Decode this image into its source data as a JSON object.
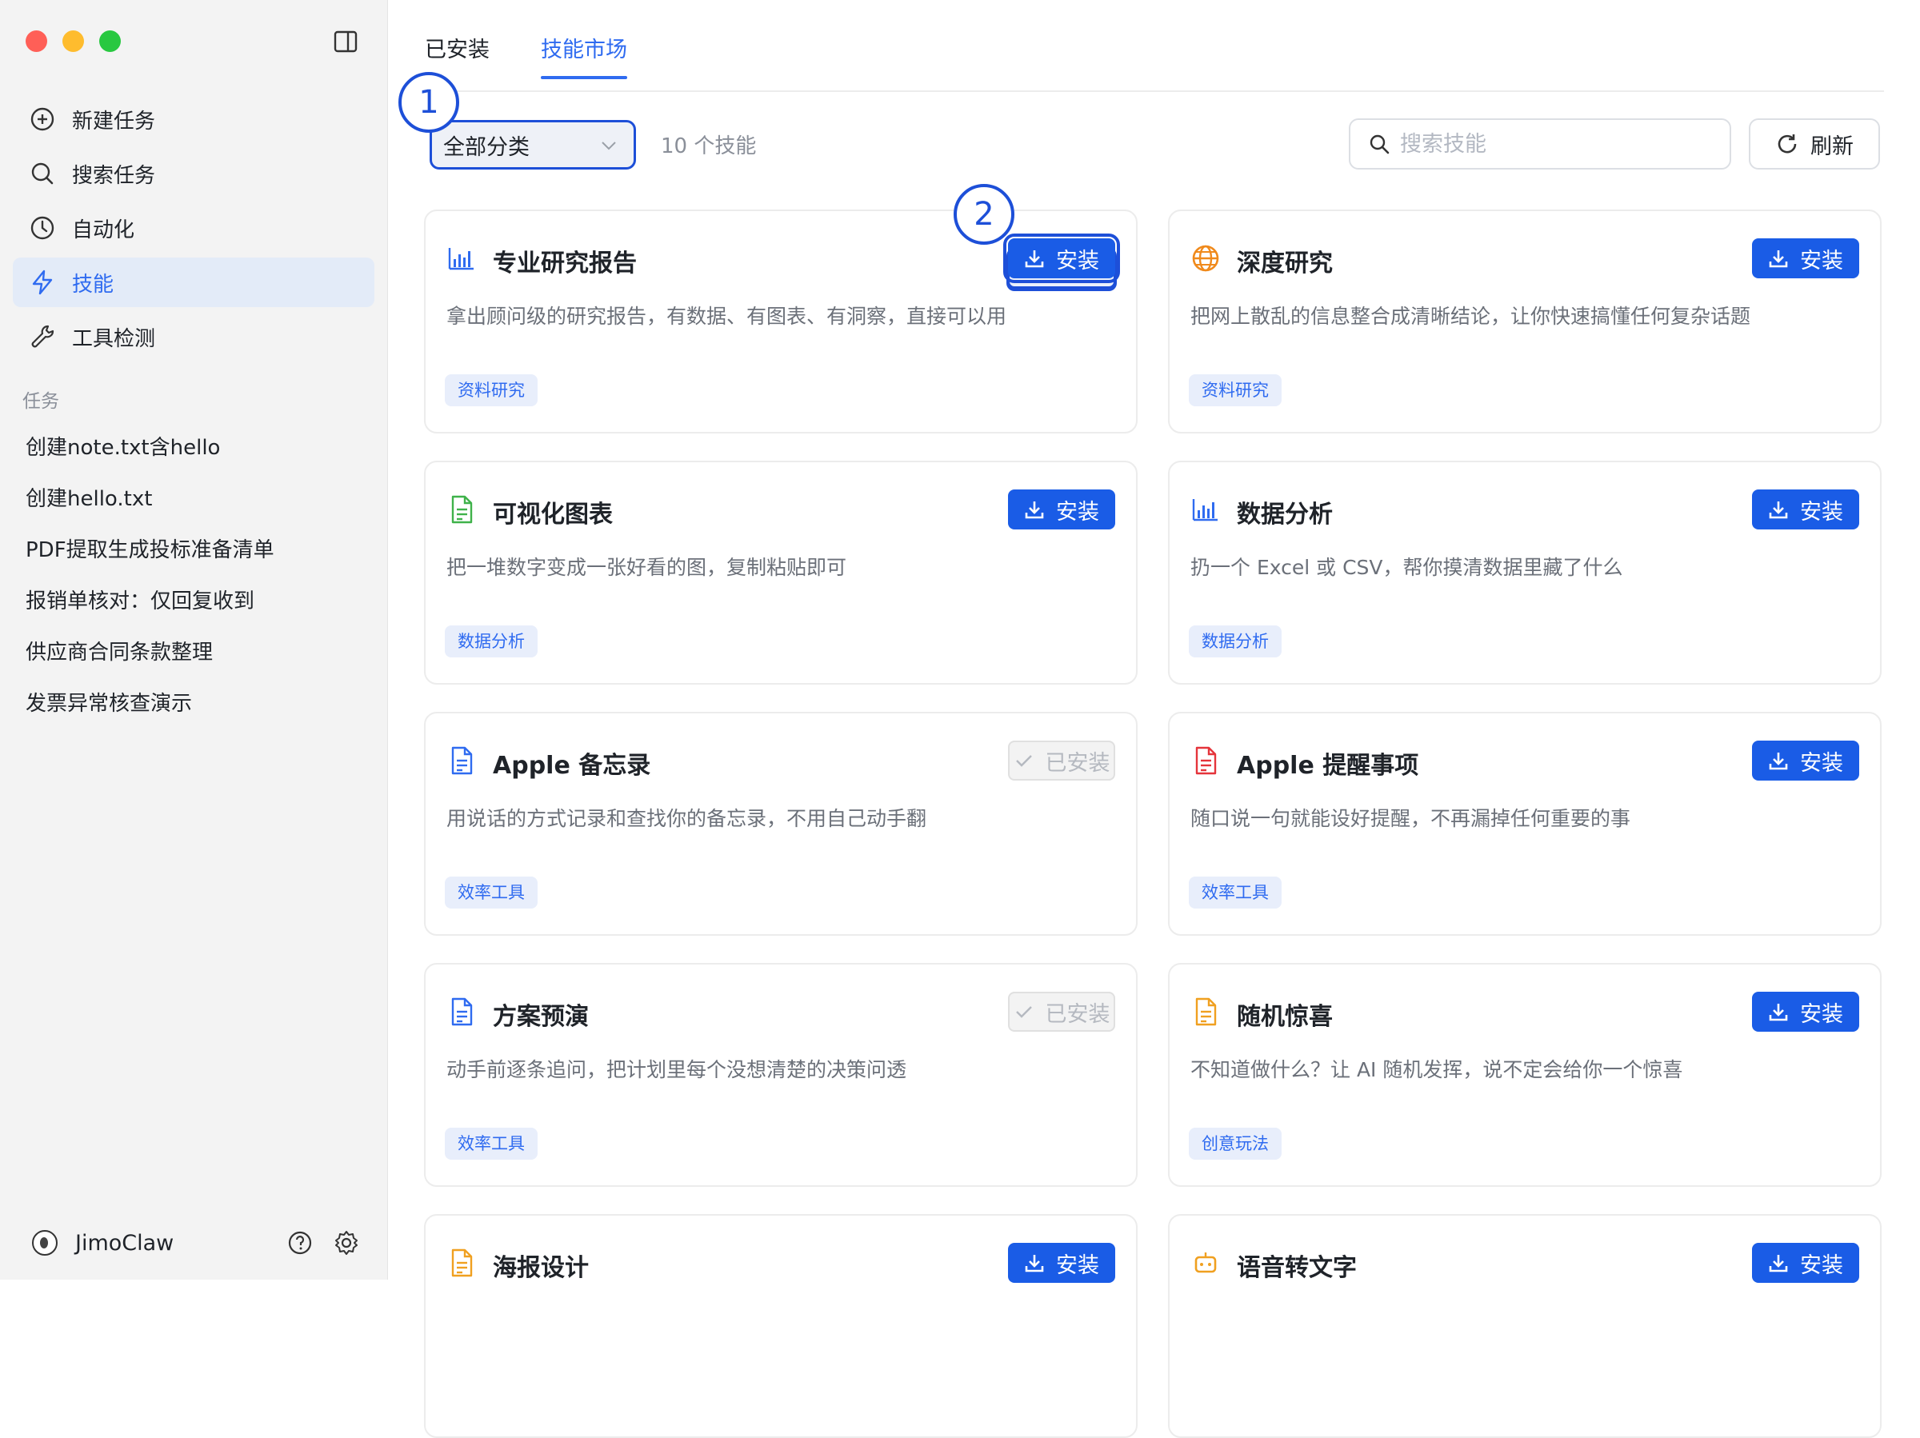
{
  "sidebar": {
    "nav": [
      {
        "label": "新建任务",
        "icon": "plus-circle-icon"
      },
      {
        "label": "搜索任务",
        "icon": "search-icon"
      },
      {
        "label": "自动化",
        "icon": "clock-icon"
      },
      {
        "label": "技能",
        "icon": "bolt-icon",
        "active": true
      },
      {
        "label": "工具检测",
        "icon": "wrench-icon"
      }
    ],
    "tasks_label": "任务",
    "tasks": [
      "创建note.txt含hello",
      "创建hello.txt",
      "PDF提取生成投标准备清单",
      "报销单核对：仅回复收到",
      "供应商合同条款整理",
      "发票异常核查演示"
    ],
    "user_name": "JimoClaw"
  },
  "main": {
    "tabs": [
      {
        "label": "已安装"
      },
      {
        "label": "技能市场",
        "active": true
      }
    ],
    "category_select": "全部分类",
    "count_text": "10 个技能",
    "search_placeholder": "搜索技能",
    "refresh_label": "刷新",
    "annotations": [
      "1",
      "2"
    ],
    "install_label": "安装",
    "installed_label": "已安装",
    "cards": [
      {
        "title": "专业研究报告",
        "desc": "拿出顾问级的研究报告，有数据、有图表、有洞察，直接可以用",
        "tag": "资料研究",
        "icon": "bar-chart-icon",
        "status": "install"
      },
      {
        "title": "深度研究",
        "desc": "把网上散乱的信息整合成清晰结论，让你快速搞懂任何复杂话题",
        "tag": "资料研究",
        "icon": "globe-icon",
        "status": "install"
      },
      {
        "title": "可视化图表",
        "desc": "把一堆数字变成一张好看的图，复制粘贴即可",
        "tag": "数据分析",
        "icon": "document-green-icon",
        "status": "install"
      },
      {
        "title": "数据分析",
        "desc": "扔一个 Excel 或 CSV，帮你摸清数据里藏了什么",
        "tag": "数据分析",
        "icon": "bar-chart-icon",
        "status": "install"
      },
      {
        "title": "Apple 备忘录",
        "desc": "用说话的方式记录和查找你的备忘录，不用自己动手翻",
        "tag": "效率工具",
        "icon": "document-blue-icon",
        "status": "installed"
      },
      {
        "title": "Apple 提醒事项",
        "desc": "随口说一句就能设好提醒，不再漏掉任何重要的事",
        "tag": "效率工具",
        "icon": "document-red-icon",
        "status": "install"
      },
      {
        "title": "方案预演",
        "desc": "动手前逐条追问，把计划里每个没想清楚的决策问透",
        "tag": "效率工具",
        "icon": "document-blue-icon",
        "status": "installed"
      },
      {
        "title": "随机惊喜",
        "desc": "不知道做什么？让 AI 随机发挥，说不定会给你一个惊喜",
        "tag": "创意玩法",
        "icon": "document-orange-icon",
        "status": "install"
      },
      {
        "title": "海报设计",
        "desc": "",
        "tag": "",
        "icon": "document-orange-icon",
        "status": "install"
      },
      {
        "title": "语音转文字",
        "desc": "",
        "tag": "",
        "icon": "robot-icon",
        "status": "install"
      }
    ]
  },
  "colors": {
    "accent": "#2f6bf0",
    "button": "#1a5ce6",
    "annotation": "#1d4fd8",
    "red": "#ff5f57",
    "yellow": "#febc2e",
    "green": "#28c840"
  }
}
